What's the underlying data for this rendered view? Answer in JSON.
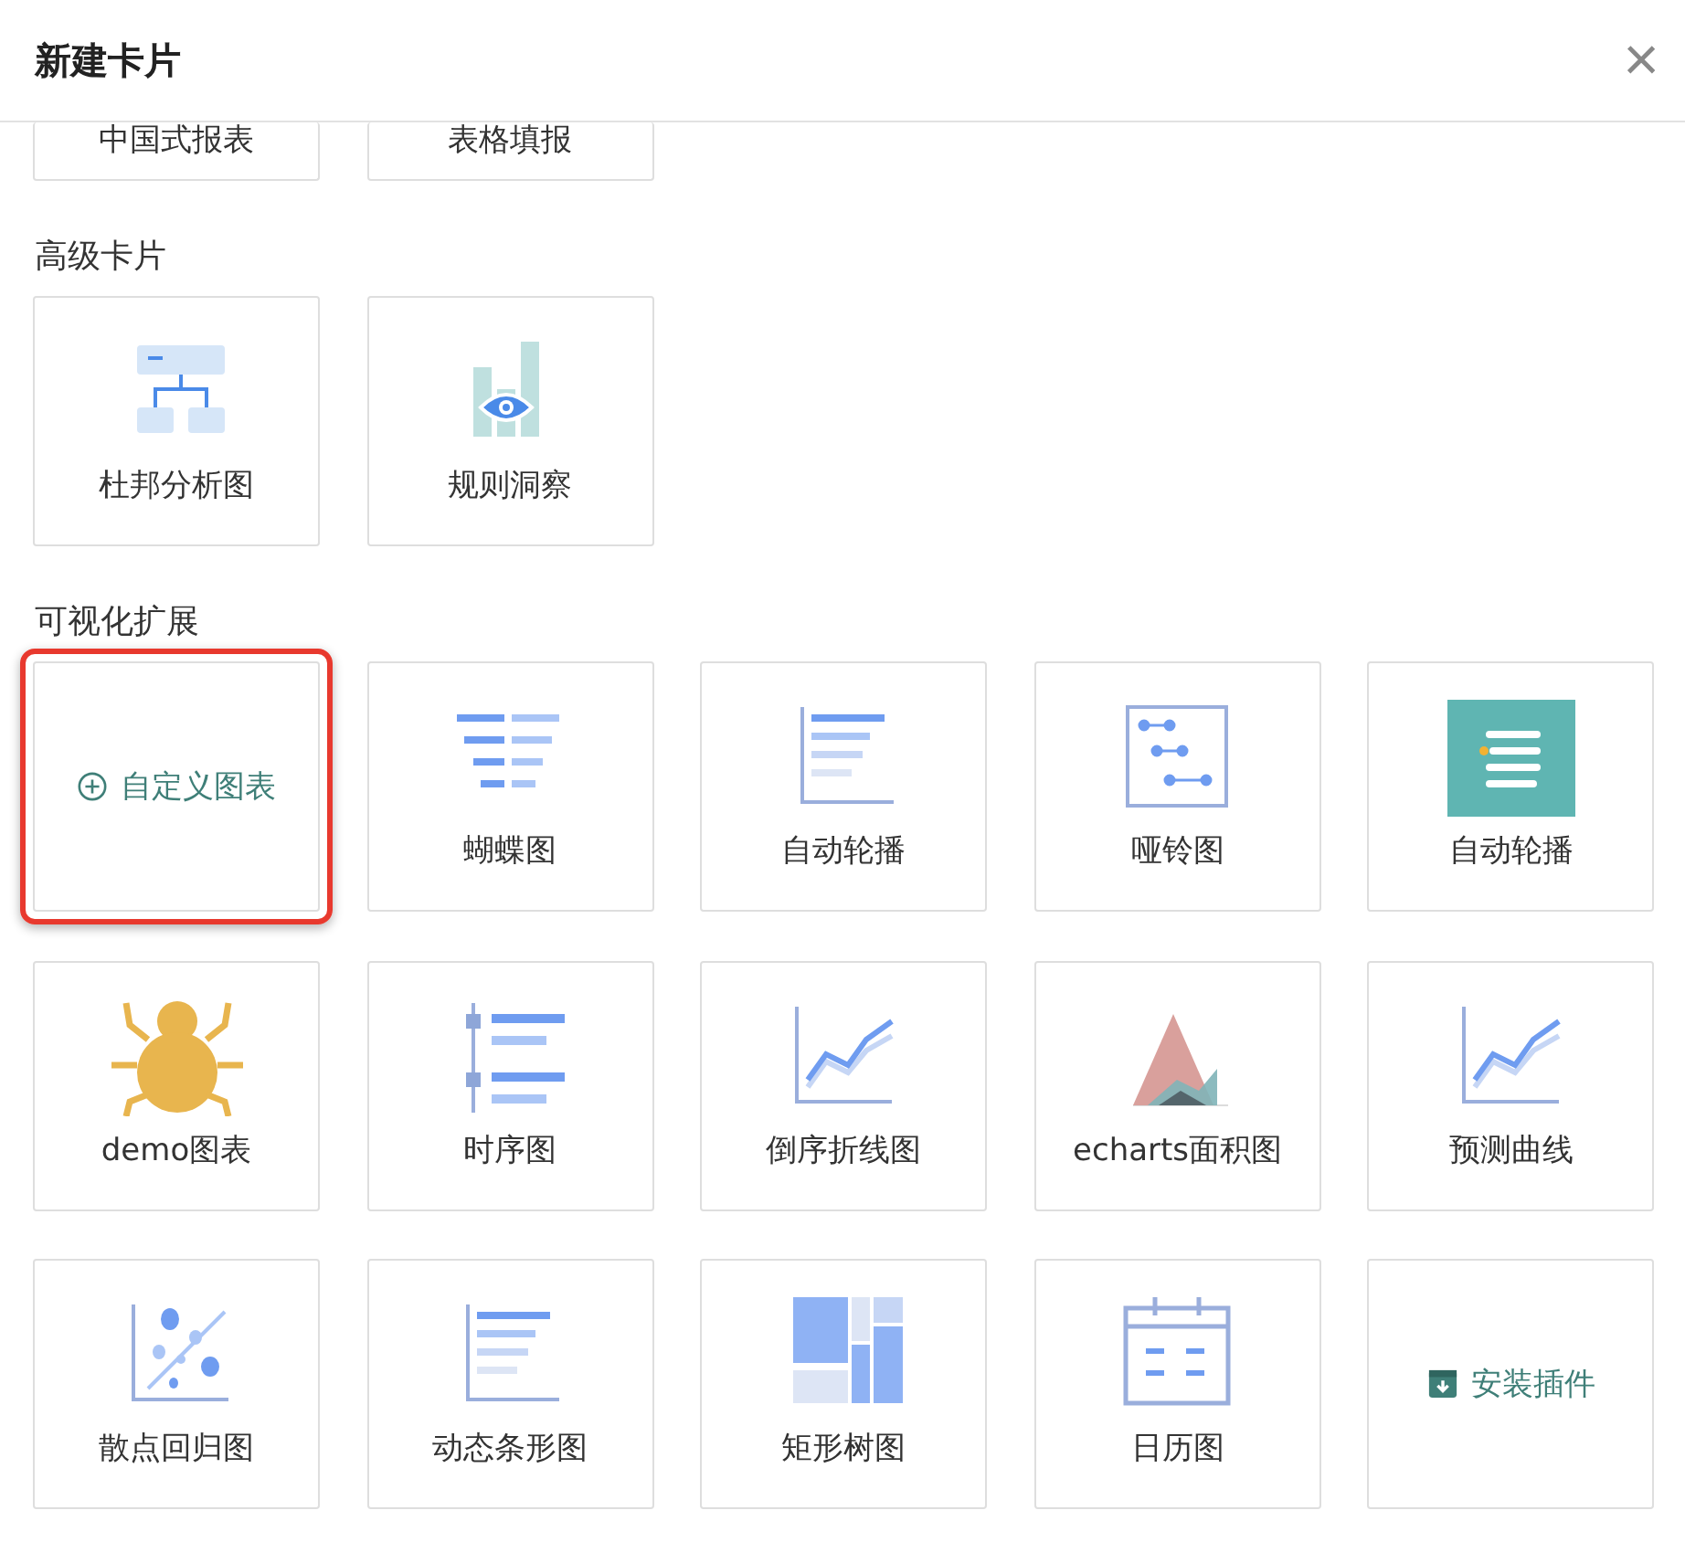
{
  "dialog": {
    "title": "新建卡片",
    "close": "×"
  },
  "sections": [
    {
      "items": [
        {
          "label": "中国式报表",
          "kind": "report"
        },
        {
          "label": "表格填报",
          "kind": "report"
        }
      ]
    },
    {
      "title": "高级卡片",
      "items": [
        {
          "label": "杜邦分析图",
          "kind": "dupont"
        },
        {
          "label": "规则洞察",
          "kind": "insight"
        }
      ]
    },
    {
      "title": "可视化扩展",
      "items": [
        {
          "label": "自定义图表",
          "kind": "custom",
          "highlighted": true
        },
        {
          "label": "蝴蝶图",
          "kind": "butterfly"
        },
        {
          "label": "自动轮播",
          "kind": "carousel"
        },
        {
          "label": "哑铃图",
          "kind": "dumbbell"
        },
        {
          "label": "自动轮播",
          "kind": "tile"
        },
        {
          "label": "demo图表",
          "kind": "bug"
        },
        {
          "label": "时序图",
          "kind": "timeline"
        },
        {
          "label": "倒序折线图",
          "kind": "line"
        },
        {
          "label": "echarts面积图",
          "kind": "area"
        },
        {
          "label": "预测曲线",
          "kind": "line"
        },
        {
          "label": "散点回归图",
          "kind": "scatter"
        },
        {
          "label": "动态条形图",
          "kind": "carousel"
        },
        {
          "label": "矩形树图",
          "kind": "treemap"
        },
        {
          "label": "日历图",
          "kind": "calendar"
        },
        {
          "label": "安装插件",
          "kind": "install"
        }
      ]
    }
  ]
}
